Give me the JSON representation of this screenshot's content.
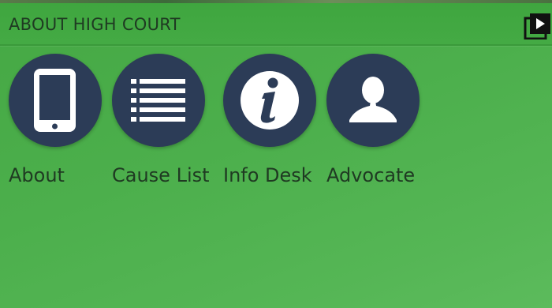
{
  "header": {
    "title": "ABOUT HIGH COURT",
    "action_icon": "play-library-icon"
  },
  "tiles": [
    {
      "label": "About",
      "icon": "tablet-icon"
    },
    {
      "label": "Cause List",
      "icon": "list-icon"
    },
    {
      "label": "Info Desk",
      "icon": "info-icon"
    },
    {
      "label": "Advocate",
      "icon": "person-icon"
    }
  ],
  "colors": {
    "background": "#4caf4c",
    "tile": "#2c3c57",
    "text": "#1f3a22"
  }
}
